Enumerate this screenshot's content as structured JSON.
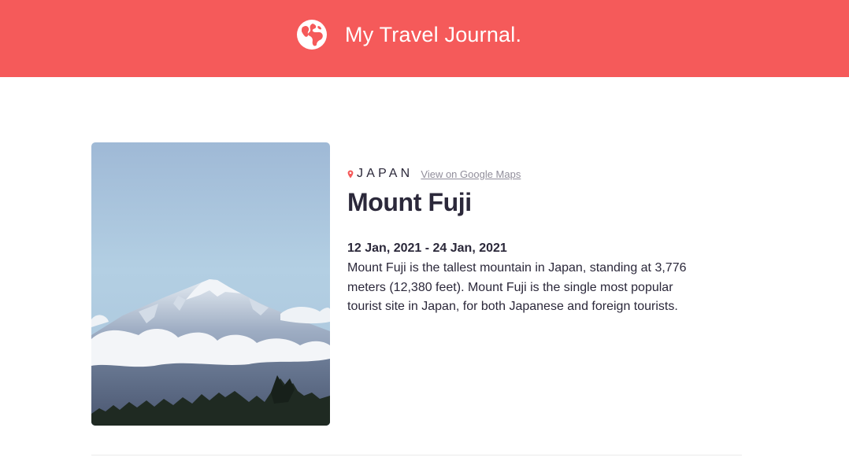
{
  "header": {
    "title": "My Travel Journal.",
    "icon": "globe-icon",
    "bg_color": "#F55A5A"
  },
  "entry": {
    "image_icon": "mount-fuji-photo",
    "location": {
      "icon": "map-pin-icon",
      "country": "JAPAN",
      "maps_link_label": "View on Google Maps"
    },
    "title": "Mount Fuji",
    "dates": "12 Jan, 2021 - 24 Jan, 2021",
    "description": "Mount Fuji is the tallest mountain in Japan, standing at 3,776 meters (12,380 feet). Mount Fuji is the single most popular tourist site in Japan, for both Japanese and foreign tourists."
  },
  "colors": {
    "accent": "#F55A5A",
    "text": "#2B283A",
    "muted": "#918E9B"
  }
}
